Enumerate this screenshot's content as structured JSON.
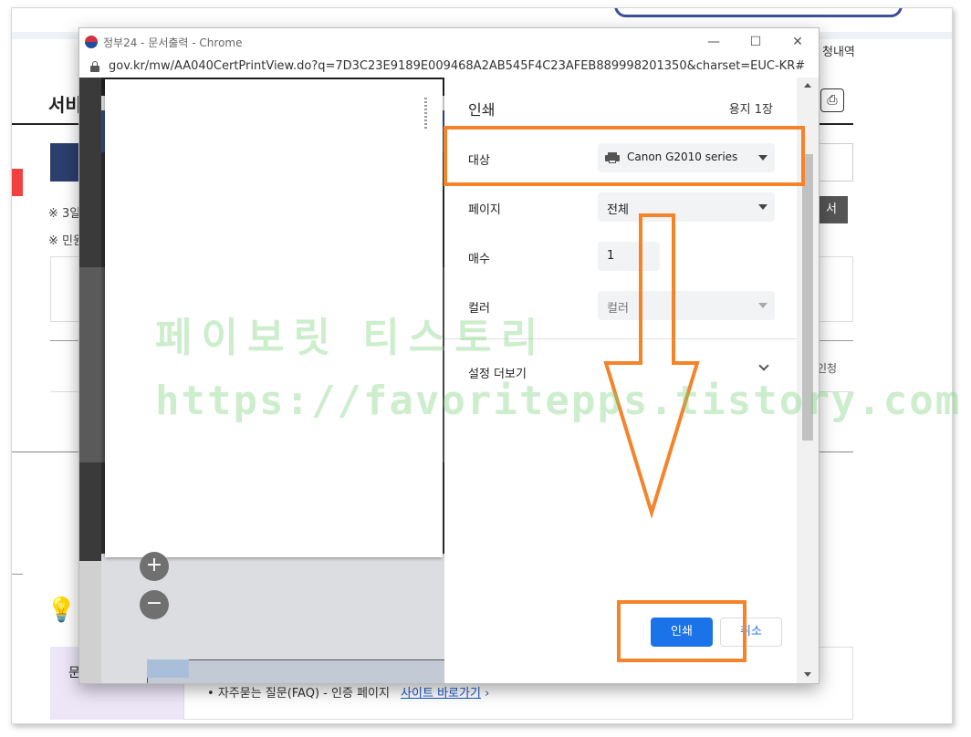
{
  "background_site": {
    "nav_link": "청내역",
    "page_title": "서비",
    "note1": "※ 3일",
    "note2": "※ 민원",
    "dark_button_label": "서",
    "right_text": "인청",
    "purple_label": "문",
    "faq_text": "자주묻는 질문(FAQ) - 인증 페이지",
    "faq_link": "사이트 바로가기"
  },
  "window": {
    "title": "정부24 - 문서출력 - Chrome",
    "url": "gov.kr/mw/AA040CertPrintView.do?q=7D3C23E9189E009468A2AB545F4C23AFEB889998201350&charset=EUC-KR#"
  },
  "preview": {
    "zoom_in": "+",
    "zoom_out": "−"
  },
  "print_dialog": {
    "title": "인쇄",
    "sheet_count": "용지 1장",
    "destination": {
      "label": "대상",
      "value": "Canon G2010 series"
    },
    "pages": {
      "label": "페이지",
      "value": "전체"
    },
    "copies": {
      "label": "매수",
      "value": "1"
    },
    "color": {
      "label": "컬러",
      "value": "컬러"
    },
    "more_settings": "설정 더보기",
    "print_button": "인쇄",
    "cancel_button": "취소"
  },
  "watermark": {
    "line1": "페이보릿 티스토리",
    "line2": "https://favoritepps.tistory.com"
  },
  "colors": {
    "annotation_orange": "#f5832a",
    "print_blue": "#1a73e8"
  }
}
